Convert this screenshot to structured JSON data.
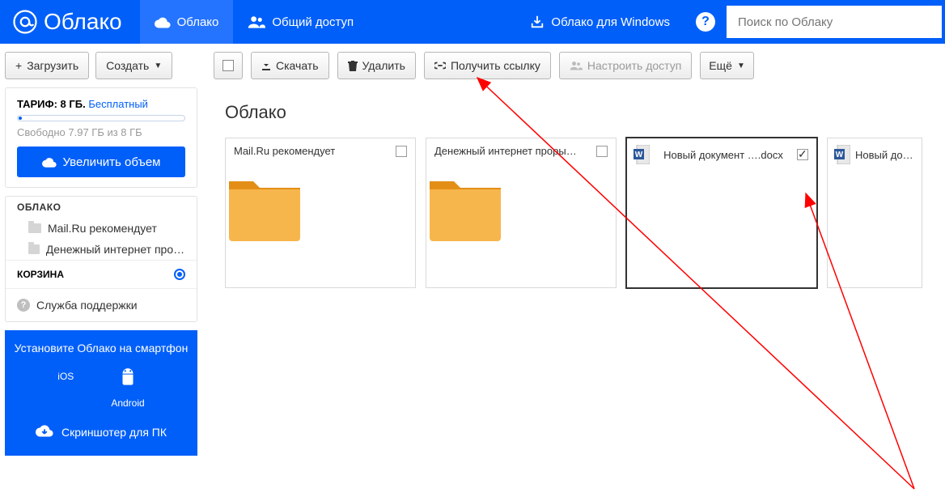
{
  "header": {
    "logo_text": "Облако",
    "nav_cloud": "Облако",
    "nav_share": "Общий доступ",
    "nav_windows": "Облако для Windows",
    "search_placeholder": "Поиск по Облаку"
  },
  "sidebar": {
    "upload": "Загрузить",
    "create": "Создать",
    "tariff_label": "ТАРИФ: 8 ГБ.",
    "tariff_plan": "Бесплатный",
    "storage_free": "Свободно 7.97 ГБ из 8 ГБ",
    "expand": "Увеличить объем",
    "section_cloud": "ОБЛАКО",
    "tree": [
      {
        "label": "Mail.Ru рекомендует"
      },
      {
        "label": "Денежный интернет прорыв …"
      }
    ],
    "trash": "КОРЗИНА",
    "support": "Служба поддержки",
    "promo_title": "Установите Облако на смартфон",
    "promo_ios": "iOS",
    "promo_android": "Android",
    "promo_shot": "Скриншотер для ПК"
  },
  "toolbar": {
    "download": "Скачать",
    "delete": "Удалить",
    "getlink": "Получить ссылку",
    "access": "Настроить доступ",
    "more": "Ещё"
  },
  "main": {
    "title": "Облако",
    "items": [
      {
        "name": "Mail.Ru рекомендует",
        "type": "folder",
        "selected": false
      },
      {
        "name": "Денежный интернет проры…",
        "type": "folder",
        "selected": false
      },
      {
        "name": "Новый документ ….docx",
        "type": "word",
        "selected": true
      },
      {
        "name": "Новый докумен",
        "type": "word",
        "selected": false
      }
    ]
  }
}
